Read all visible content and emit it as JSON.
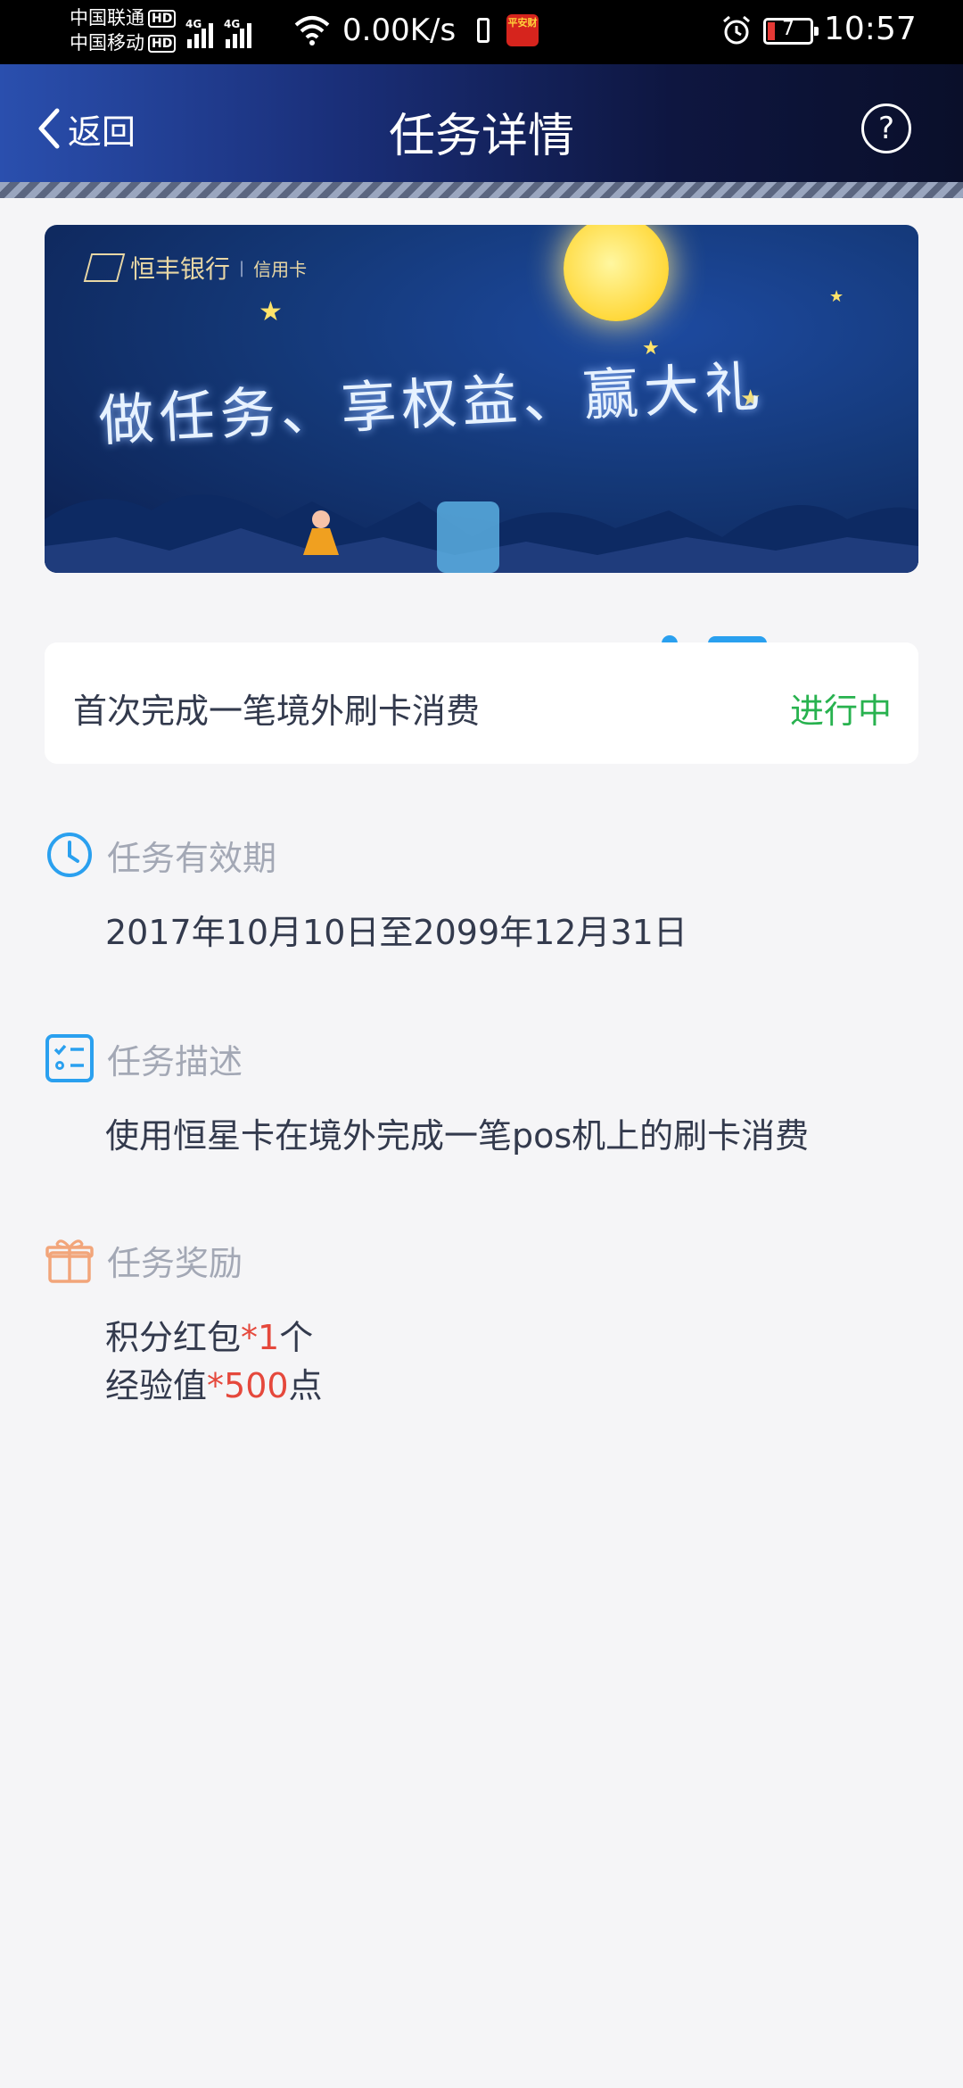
{
  "status_bar": {
    "carrier1": "中国联通",
    "carrier2": "中国移动",
    "hd": "HD",
    "net1": "4G",
    "net2": "4G",
    "speed": "0.00K/s",
    "app_badge": "平安财",
    "battery": "7",
    "time": "10:57"
  },
  "nav": {
    "back_label": "返回",
    "title": "任务详情",
    "help": "?"
  },
  "banner": {
    "bank_name": "恒丰银行",
    "card_label": "信用卡",
    "slogan": "做任务、享权益、赢大礼"
  },
  "task": {
    "name": "首次完成一笔境外刷卡消费",
    "status": "进行中"
  },
  "sections": {
    "validity": {
      "title": "任务有效期",
      "text": "2017年10月10日至2099年12月31日"
    },
    "description": {
      "title": "任务描述",
      "text": "使用恒星卡在境外完成一笔pos机上的刷卡消费"
    },
    "reward": {
      "title": "任务奖励",
      "line1_prefix": "积分红包",
      "line1_qty": "*1",
      "line1_suffix": "个",
      "line2_prefix": "经验值",
      "line2_qty": "*500",
      "line2_suffix": "点"
    }
  },
  "colors": {
    "status_green": "#28b24f",
    "highlight_red": "#e5483c",
    "icon_blue": "#2aa0ef",
    "gift_orange": "#f2a57a"
  }
}
